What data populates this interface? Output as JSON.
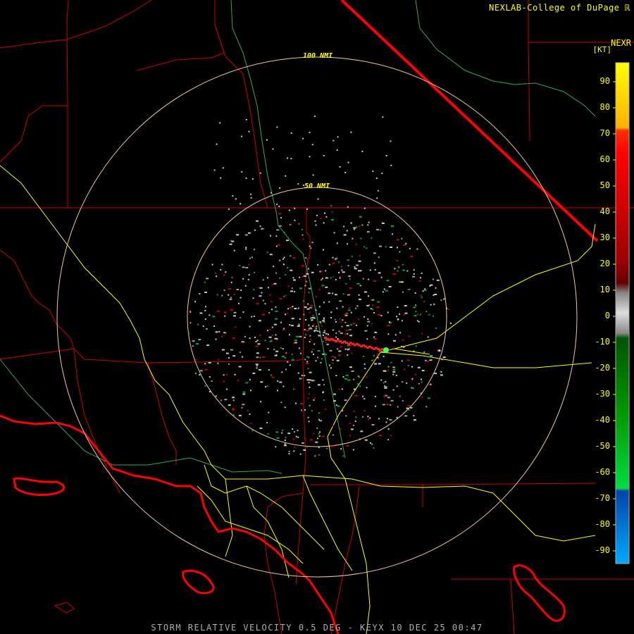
{
  "header": {
    "credit": "NEXLAB-College of DuPage",
    "credit_mark": "ℝ",
    "product": "NEXR",
    "unit": "[KT]"
  },
  "footer": {
    "caption": "STORM RELATIVE VELOCITY 0.5 DEG - KEYX 10 DEC 25 00:47"
  },
  "range_rings": {
    "inner_label": "50 NMI",
    "outer_label": "100 NMI"
  },
  "colorbar": {
    "ticks": [
      "90",
      "80",
      "70",
      "60",
      "50",
      "40",
      "30",
      "20",
      "10",
      "0",
      "-10",
      "-20",
      "-30",
      "-40",
      "-50",
      "-60",
      "-70",
      "-80",
      "-90"
    ]
  },
  "colors": {
    "background": "#000000",
    "borders": "#cc0000",
    "highways": "#ffff00",
    "rivers": "#33aa55",
    "range_ring": "#f0c8a0",
    "coastline": "#ff0000"
  }
}
